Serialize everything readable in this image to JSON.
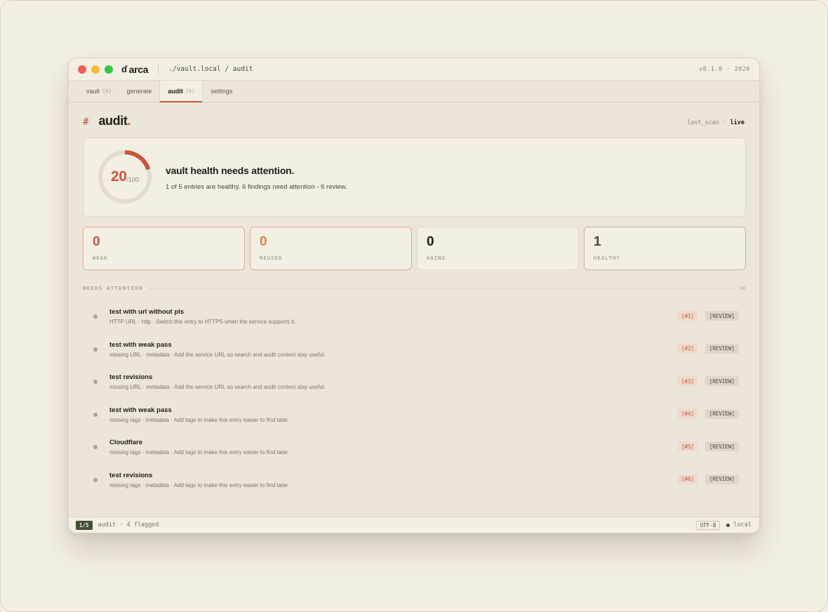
{
  "window": {
    "app_name": "arca",
    "path": "./vault.local / audit",
    "version": "v0.1.0 · 2026"
  },
  "tabs": [
    {
      "label": "vault",
      "count": "[6]"
    },
    {
      "label": "generate",
      "count": ""
    },
    {
      "label": "audit",
      "count": "[6]",
      "active": true
    },
    {
      "label": "settings",
      "count": ""
    }
  ],
  "page": {
    "hash": "#",
    "title": "audit",
    "title_dot": ".",
    "scan_label": "last_scan ·",
    "scan_value": "live"
  },
  "health": {
    "score": "20",
    "score_max": "/100",
    "score_fraction": 0.2,
    "title": "vault health needs attention.",
    "subtitle": "1 of 5 entries are healthy. 6 findings need attention - 6 review.",
    "colors": {
      "accent": "#c8553d",
      "track": "#e2ddcf"
    }
  },
  "stats": [
    {
      "value": "0",
      "label": "WEAK",
      "color": "#c8553d"
    },
    {
      "value": "0",
      "label": "REUSED",
      "color": "#d9834f"
    },
    {
      "value": "0",
      "label": "AGING",
      "color": "#1f1d18"
    },
    {
      "value": "1",
      "label": "HEALTHY",
      "color": "#3f4a33"
    }
  ],
  "section": {
    "label": "NEEDS ATTENTION",
    "count": "06"
  },
  "findings": [
    {
      "title": "test with url without pls",
      "desc": "HTTP URL · http · Switch this entry to HTTPS when the service supports it.",
      "num": "[#1]",
      "action": "[REVIEW]"
    },
    {
      "title": "test with weak pass",
      "desc": "missing URL · metadata · Add the service URL so search and audit context stay useful.",
      "num": "[#2]",
      "action": "[REVIEW]"
    },
    {
      "title": "test revisions",
      "desc": "missing URL · metadata · Add the service URL so search and audit context stay useful.",
      "num": "[#3]",
      "action": "[REVIEW]"
    },
    {
      "title": "test with weak pass",
      "desc": "missing tags · metadata · Add tags to make this entry easier to find later.",
      "num": "[#4]",
      "action": "[REVIEW]"
    },
    {
      "title": "Cloudflare",
      "desc": "missing tags · metadata · Add tags to make this entry easier to find later.",
      "num": "[#5]",
      "action": "[REVIEW]"
    },
    {
      "title": "test revisions",
      "desc": "missing tags · metadata · Add tags to make this entry easier to find later.",
      "num": "[#6]",
      "action": "[REVIEW]"
    }
  ],
  "statusbar": {
    "pager": "1/5",
    "text": "audit · 4 flagged",
    "encoding": "UTF-8",
    "location": "local"
  }
}
